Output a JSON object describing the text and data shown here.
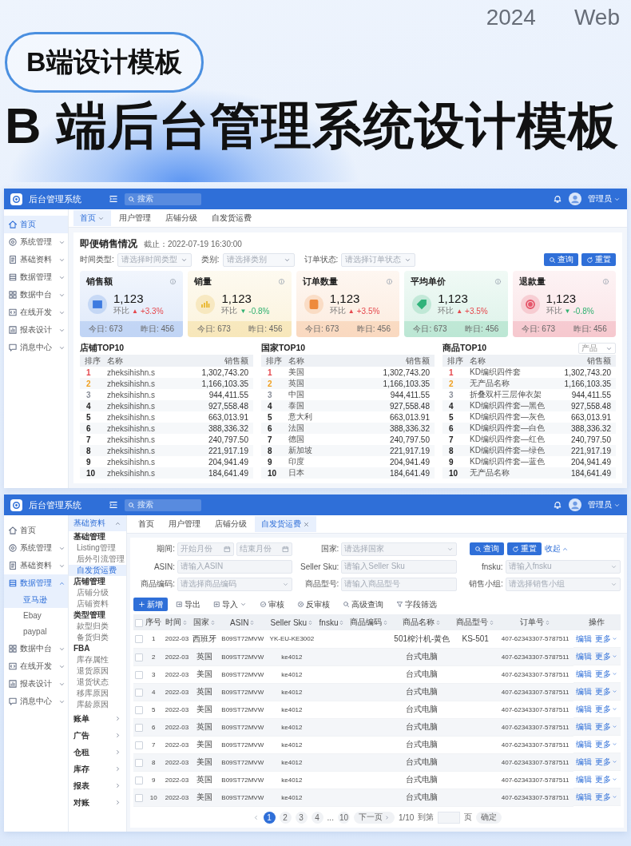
{
  "poster": {
    "year": "2024",
    "platform": "Web",
    "badge": "B端设计模板",
    "headline": "B 端后台管理系统设计模板"
  },
  "dashboard": {
    "app_title": "后台管理系统",
    "search": {
      "placeholder": "搜索"
    },
    "user": "管理员",
    "sidebar": [
      {
        "label": "首页",
        "selected": true
      },
      {
        "label": "系统管理",
        "selected": false,
        "expanded": false
      },
      {
        "label": "基础资料",
        "selected": false,
        "expanded": false
      },
      {
        "label": "数据管理",
        "selected": false,
        "expanded": false
      },
      {
        "label": "数据中台",
        "selected": false,
        "expanded": false
      },
      {
        "label": "在线开发",
        "selected": false,
        "expanded": false
      },
      {
        "label": "报表设计",
        "selected": false,
        "expanded": false
      },
      {
        "label": "消息中心",
        "selected": false,
        "expanded": false
      }
    ],
    "tabs": [
      {
        "label": "首页",
        "selected": true,
        "has_menu": true
      },
      {
        "label": "用户管理",
        "selected": false
      },
      {
        "label": "店铺分级",
        "selected": false
      },
      {
        "label": "自发货运费",
        "selected": false
      }
    ],
    "title": "即便销售情况",
    "as_of": "截止：2022-07-19 16:30:00",
    "filters": [
      {
        "label": "时间类型:",
        "placeholder": "请选择时间类型"
      },
      {
        "label": "类别:",
        "placeholder": "请选择类别"
      },
      {
        "label": "订单状态:",
        "placeholder": "请选择订单状态"
      }
    ],
    "buttons": [
      {
        "label": "查询",
        "kind": "search"
      },
      {
        "label": "重置",
        "kind": "reset"
      }
    ],
    "stats": [
      {
        "title": "销售额",
        "value": "1,123",
        "change_label": "环比",
        "kind": "rise",
        "arrow": "▲",
        "change": "+3.3%",
        "today": "今日: 673",
        "yesterday": "昨日: 456",
        "color": "#3d7be0"
      },
      {
        "title": "销量",
        "value": "1,123",
        "change_label": "环比",
        "kind": "fall",
        "arrow": "▼",
        "change": "-0.8%",
        "today": "今日: 673",
        "yesterday": "昨日: 456",
        "color": "#e8b62c"
      },
      {
        "title": "订单数量",
        "value": "1,123",
        "change_label": "环比",
        "kind": "rise",
        "arrow": "▲",
        "change": "+3.5%",
        "today": "今日: 673",
        "yesterday": "昨日: 456",
        "color": "#ee8a3c"
      },
      {
        "title": "平均单价",
        "value": "1,123",
        "change_label": "环比",
        "kind": "rise",
        "arrow": "▲",
        "change": "+3.5%",
        "today": "今日: 673",
        "yesterday": "昨日: 456",
        "color": "#2fb37a"
      },
      {
        "title": "退款量",
        "value": "1,123",
        "change_label": "环比",
        "kind": "fall",
        "arrow": "▼",
        "change": "-0.8%",
        "today": "今日: 673",
        "yesterday": "昨日: 456",
        "color": "#e5566a"
      }
    ],
    "rankings": [
      {
        "title": "店铺TOP10",
        "columns": [
          "排序",
          "名称",
          "销售额"
        ],
        "rows": [
          {
            "rank": "1",
            "name": "zheksihishn.s",
            "amount": "1,302,743.20",
            "color": "#e5484d"
          },
          {
            "rank": "2",
            "name": "zheksihishn.s",
            "amount": "1,166,103.35",
            "color": "#f0a020"
          },
          {
            "rank": "3",
            "name": "zheksihishn.s",
            "amount": "944,411.55",
            "color": "#8a8f99"
          },
          {
            "rank": "4",
            "name": "zheksihishn.s",
            "amount": "927,558.48",
            "color": "#222222"
          },
          {
            "rank": "5",
            "name": "zheksihishn.s",
            "amount": "663,013.91",
            "color": "#222222"
          },
          {
            "rank": "6",
            "name": "zheksihishn.s",
            "amount": "388,336.32",
            "color": "#222222"
          },
          {
            "rank": "7",
            "name": "zheksihishn.s",
            "amount": "240,797.50",
            "color": "#222222"
          },
          {
            "rank": "8",
            "name": "zheksihishn.s",
            "amount": "221,917.19",
            "color": "#222222"
          },
          {
            "rank": "9",
            "name": "zheksihishn.s",
            "amount": "204,941.49",
            "color": "#222222"
          },
          {
            "rank": "10",
            "name": "zheksihishn.s",
            "amount": "184,641.49",
            "color": "#222222"
          }
        ]
      },
      {
        "title": "国家TOP10",
        "columns": [
          "排序",
          "名称",
          "销售额"
        ],
        "rows": [
          {
            "rank": "1",
            "name": "美国",
            "amount": "1,302,743.20",
            "color": "#e5484d"
          },
          {
            "rank": "2",
            "name": "英国",
            "amount": "1,166,103.35",
            "color": "#f0a020"
          },
          {
            "rank": "3",
            "name": "中国",
            "amount": "944,411.55",
            "color": "#8a8f99"
          },
          {
            "rank": "4",
            "name": "泰国",
            "amount": "927,558.48",
            "color": "#222222"
          },
          {
            "rank": "5",
            "name": "意大利",
            "amount": "663,013.91",
            "color": "#222222"
          },
          {
            "rank": "6",
            "name": "法国",
            "amount": "388,336.32",
            "color": "#222222"
          },
          {
            "rank": "7",
            "name": "德国",
            "amount": "240,797.50",
            "color": "#222222"
          },
          {
            "rank": "8",
            "name": "新加坡",
            "amount": "221,917.19",
            "color": "#222222"
          },
          {
            "rank": "9",
            "name": "印度",
            "amount": "204,941.49",
            "color": "#222222"
          },
          {
            "rank": "10",
            "name": "日本",
            "amount": "184,641.49",
            "color": "#222222"
          }
        ]
      },
      {
        "title": "商品TOP10",
        "select": "产品",
        "columns": [
          "排序",
          "名称",
          "销售额"
        ],
        "rows": [
          {
            "rank": "1",
            "name": "KD编织四件套",
            "amount": "1,302,743.20",
            "color": "#e5484d"
          },
          {
            "rank": "2",
            "name": "无产品名称",
            "amount": "1,166,103.35",
            "color": "#f0a020"
          },
          {
            "rank": "3",
            "name": "折叠双杆三层伸衣架",
            "amount": "944,411.55",
            "color": "#8a8f99"
          },
          {
            "rank": "4",
            "name": "KD编织四件套—黑色",
            "amount": "927,558.48",
            "color": "#222222"
          },
          {
            "rank": "5",
            "name": "KD编织四件套—灰色",
            "amount": "663,013.91",
            "color": "#222222"
          },
          {
            "rank": "6",
            "name": "KD编织四件套—白色",
            "amount": "388,336.32",
            "color": "#222222"
          },
          {
            "rank": "7",
            "name": "KD编织四件套—红色",
            "amount": "240,797.50",
            "color": "#222222"
          },
          {
            "rank": "8",
            "name": "KD编织四件套—绿色",
            "amount": "221,917.19",
            "color": "#222222"
          },
          {
            "rank": "9",
            "name": "KD编织四件套—蓝色",
            "amount": "204,941.49",
            "color": "#222222"
          },
          {
            "rank": "10",
            "name": "无产品名称",
            "amount": "184,641.49",
            "color": "#222222"
          }
        ]
      }
    ]
  },
  "listing": {
    "app_title": "后台管理系统",
    "search": {
      "placeholder": "搜索"
    },
    "user": "管理员",
    "sidebar": [
      {
        "label": "首页",
        "selected": false
      },
      {
        "label": "系统管理",
        "selected": false,
        "expanded": false
      },
      {
        "label": "基础资料",
        "selected": false,
        "expanded": false
      },
      {
        "label": "数据管理",
        "selected": true,
        "expanded": true,
        "children": [
          {
            "label": "亚马逊",
            "selected": true
          },
          {
            "label": "Ebay",
            "selected": false
          },
          {
            "label": "paypal",
            "selected": false
          }
        ]
      },
      {
        "label": "数据中台",
        "selected": false,
        "expanded": false
      },
      {
        "label": "在线开发",
        "selected": false,
        "expanded": false
      },
      {
        "label": "报表设计",
        "selected": false,
        "expanded": false
      },
      {
        "label": "消息中心",
        "selected": false,
        "expanded": false
      }
    ],
    "submenu": {
      "title": "基础资料",
      "expanded": true,
      "groups": [
        {
          "title": "基础管理",
          "items": [
            {
              "label": "Listing管理",
              "selected": false
            },
            {
              "label": "后外引流管理",
              "selected": false
            },
            {
              "label": "自发货运费",
              "selected": true
            }
          ]
        },
        {
          "title": "店铺管理",
          "items": [
            {
              "label": "店铺分级",
              "selected": false
            },
            {
              "label": "店铺资料",
              "selected": false
            }
          ]
        },
        {
          "title": "类型管理",
          "items": [
            {
              "label": "款型归类",
              "selected": false
            },
            {
              "label": "备货归类",
              "selected": false
            }
          ]
        },
        {
          "title": "FBA",
          "items": [
            {
              "label": "库存属性",
              "selected": false
            },
            {
              "label": "退货原因",
              "selected": false
            },
            {
              "label": "退货状态",
              "selected": false
            },
            {
              "label": "移库原因",
              "selected": false
            },
            {
              "label": "库龄原因",
              "selected": false
            }
          ]
        }
      ],
      "sections": [
        "账单",
        "广告",
        "仓租",
        "库存",
        "报表",
        "对账"
      ]
    },
    "tabs": [
      {
        "label": "首页",
        "selected": false
      },
      {
        "label": "用户管理",
        "selected": false
      },
      {
        "label": "店铺分级",
        "selected": false
      },
      {
        "label": "自发货运费",
        "selected": true,
        "closable": true
      }
    ],
    "filters": [
      {
        "label": "期间:",
        "kind": "range",
        "placeholders": [
          "开始月份",
          "结束月份"
        ]
      },
      {
        "label": "国家:",
        "kind": "select",
        "placeholder": "请选择国家"
      },
      {
        "label": "ASIN:",
        "kind": "input",
        "placeholder": "请输入ASIN"
      },
      {
        "label": "Seller Sku:",
        "kind": "input",
        "placeholder": "请输入Seller Sku"
      },
      {
        "label": "fnsku:",
        "kind": "select",
        "placeholder": "请输入fnsku"
      },
      {
        "label": "商品编码:",
        "kind": "select",
        "placeholder": "请选择商品编码"
      },
      {
        "label": "商品型号:",
        "kind": "input",
        "placeholder": "请输入商品型号"
      },
      {
        "label": "销售小组:",
        "kind": "select",
        "placeholder": "请选择销售小组"
      }
    ],
    "form_buttons": [
      {
        "label": "查询",
        "kind": "search"
      },
      {
        "label": "重置",
        "kind": "reset"
      }
    ],
    "collapse": "收起",
    "toolbar": [
      {
        "label": "新增",
        "kind": "add"
      },
      {
        "label": "导出",
        "kind": "export"
      },
      {
        "label": "导入",
        "kind": "import"
      },
      {
        "label": "审核",
        "kind": "approve"
      },
      {
        "label": "反审核",
        "kind": "unapprove"
      },
      {
        "label": "高级查询",
        "kind": "query"
      },
      {
        "label": "字段筛选",
        "kind": "filter"
      }
    ],
    "table": {
      "all_checked": false,
      "columns": [
        {
          "label": "序号",
          "sortable": false
        },
        {
          "label": "时间",
          "sortable": true
        },
        {
          "label": "国家",
          "sortable": true
        },
        {
          "label": "ASIN",
          "sortable": true
        },
        {
          "label": "Seller Sku",
          "sortable": true
        },
        {
          "label": "fnsku",
          "sortable": true
        },
        {
          "label": "商品编码",
          "sortable": true
        },
        {
          "label": "商品名称",
          "sortable": true
        },
        {
          "label": "商品型号",
          "sortable": true
        },
        {
          "label": "订单号",
          "sortable": true
        },
        {
          "label": "操作",
          "sortable": false
        }
      ],
      "rows": [
        {
          "checked": false,
          "no": "1",
          "time": "2022-03",
          "country": "西班牙",
          "asin": "B09ST72MVW",
          "sku": "YK-EU-KE3002",
          "name": "501榨汁机-黄色",
          "model": "KS-501",
          "order": "407-62343307-5787511",
          "edit": "编辑",
          "more": "更多"
        },
        {
          "checked": false,
          "no": "2",
          "time": "2022-03",
          "country": "英国",
          "asin": "B09ST72MVW",
          "sku": "ke4012",
          "name": "台式电脑",
          "order": "407-62343307-5787511",
          "edit": "编辑",
          "more": "更多"
        },
        {
          "checked": false,
          "no": "3",
          "time": "2022-03",
          "country": "美国",
          "asin": "B09ST72MVW",
          "sku": "ke4012",
          "name": "台式电脑",
          "order": "407-62343307-5787511",
          "edit": "编辑",
          "more": "更多"
        },
        {
          "checked": false,
          "no": "4",
          "time": "2022-03",
          "country": "英国",
          "asin": "B09ST72MVW",
          "sku": "ke4012",
          "name": "台式电脑",
          "order": "407-62343307-5787511",
          "edit": "编辑",
          "more": "更多"
        },
        {
          "checked": false,
          "no": "5",
          "time": "2022-03",
          "country": "美国",
          "asin": "B09ST72MVW",
          "sku": "ke4012",
          "name": "台式电脑",
          "order": "407-62343307-5787511",
          "edit": "编辑",
          "more": "更多"
        },
        {
          "checked": false,
          "no": "6",
          "time": "2022-03",
          "country": "英国",
          "asin": "B09ST72MVW",
          "sku": "ke4012",
          "name": "台式电脑",
          "order": "407-62343307-5787511",
          "edit": "编辑",
          "more": "更多"
        },
        {
          "checked": false,
          "no": "7",
          "time": "2022-03",
          "country": "美国",
          "asin": "B09ST72MVW",
          "sku": "ke4012",
          "name": "台式电脑",
          "order": "407-62343307-5787511",
          "edit": "编辑",
          "more": "更多"
        },
        {
          "checked": false,
          "no": "8",
          "time": "2022-03",
          "country": "美国",
          "asin": "B09ST72MVW",
          "sku": "ke4012",
          "name": "台式电脑",
          "order": "407-62343307-5787511",
          "edit": "编辑",
          "more": "更多"
        },
        {
          "checked": false,
          "no": "9",
          "time": "2022-03",
          "country": "英国",
          "asin": "B09ST72MVW",
          "sku": "ke4012",
          "name": "台式电脑",
          "order": "407-62343307-5787511",
          "edit": "编辑",
          "more": "更多"
        },
        {
          "checked": false,
          "no": "10",
          "time": "2022-03",
          "country": "美国",
          "asin": "B09ST72MVW",
          "sku": "ke4012",
          "name": "台式电脑",
          "order": "407-62343307-5787511",
          "edit": "编辑",
          "more": "更多"
        }
      ]
    },
    "pagination": {
      "pages": [
        {
          "kind": "page",
          "label": "1",
          "selected": true
        },
        {
          "kind": "page",
          "label": "2",
          "selected": false
        },
        {
          "kind": "page",
          "label": "3",
          "selected": false
        },
        {
          "kind": "page",
          "label": "4",
          "selected": false
        },
        {
          "kind": "ellipsis",
          "label": "..."
        },
        {
          "kind": "page",
          "label": "10",
          "selected": false
        }
      ],
      "next": "下一页",
      "summary": "1/10",
      "goto": "到第",
      "unit": "页",
      "confirm": "确定"
    }
  }
}
